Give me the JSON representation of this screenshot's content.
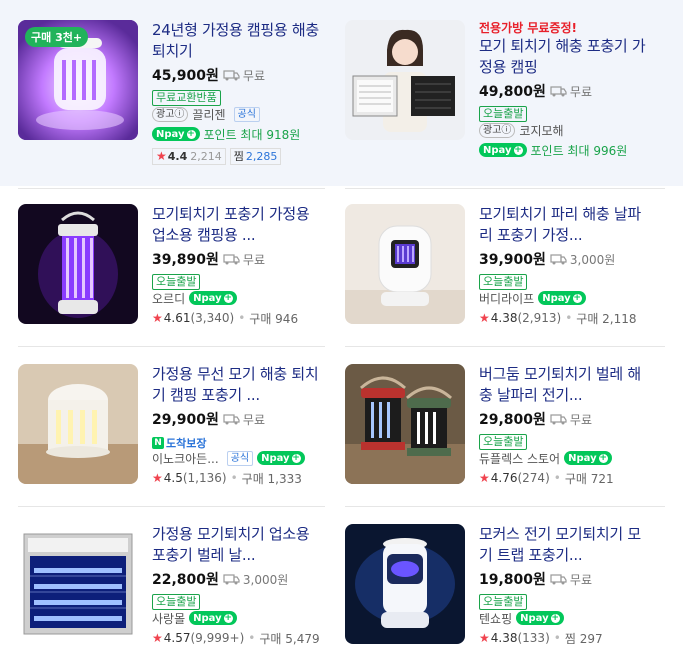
{
  "products": [
    {
      "badge": "구매 3천+",
      "title": "24년형 가정용 캠핑용 해충 퇴치기",
      "price": "45,900원",
      "shipping": "무료",
      "tag": "무료교환반품",
      "ad": "광고ⓘ",
      "seller": "끌리젠",
      "official": "공식",
      "npay": "pay",
      "point": "포인트 최대 918원",
      "rating": "4.4",
      "reviews": "2,214",
      "wish_label": "찜",
      "wish": "2,285"
    },
    {
      "promo": "전용가방 무료증정!",
      "title": "모기 퇴치기 해충 포충기 가정용 캠핑",
      "price": "49,800원",
      "shipping": "무료",
      "tag": "오늘출발",
      "ad": "광고ⓘ",
      "seller": "코지모해",
      "npay": "pay",
      "point": "포인트 최대 996원"
    },
    {
      "title": "모기퇴치기 포충기 가정용 업소용 캠핑용 ...",
      "price": "39,890원",
      "shipping": "무료",
      "tag": "오늘출발",
      "seller": "오르디",
      "npay": "pay",
      "rating": "4.61",
      "reviews": "(3,340)",
      "purchase": "구매 946"
    },
    {
      "title": "모기퇴치기 파리 해충 날파리 포충기 가정...",
      "price": "39,900원",
      "shipping": "3,000원",
      "tag": "오늘출발",
      "seller": "버디라이프",
      "npay": "pay",
      "rating": "4.38",
      "reviews": "(2,913)",
      "purchase": "구매 2,118"
    },
    {
      "title": "가정용 무선 모기 해충 퇴치기 캠핑 포충기 ...",
      "price": "29,900원",
      "shipping": "무료",
      "dochak": "도착보장",
      "seller": "이노크아든...",
      "official": "공식",
      "npay": "pay",
      "rating": "4.5",
      "reviews": "(1,136)",
      "purchase": "구매 1,333"
    },
    {
      "title": "버그둠 모기퇴치기 벌레 해충 날파리 전기...",
      "price": "29,800원",
      "shipping": "무료",
      "tag": "오늘출발",
      "seller": "듀플렉스 스토어",
      "npay": "pay",
      "rating": "4.76",
      "reviews": "(274)",
      "purchase": "구매 721"
    },
    {
      "title": "가정용 모기퇴치기 업소용 포충기 벌레 날...",
      "price": "22,800원",
      "shipping": "3,000원",
      "tag": "오늘출발",
      "seller": "사랑몰",
      "npay": "pay",
      "rating": "4.57",
      "reviews": "(9,999+)",
      "purchase": "구매 5,479"
    },
    {
      "title": "모커스 전기 모기퇴치기 모기 트랩 포충기...",
      "price": "19,800원",
      "shipping": "무료",
      "tag": "오늘출발",
      "seller": "텐쇼핑",
      "npay": "pay",
      "rating": "4.38",
      "reviews": "(133)",
      "purchase": "찜 297"
    }
  ],
  "colors": {
    "title": "#1d2c84",
    "green": "#1aa34a",
    "npay": "#03c75a",
    "star": "#f0434e",
    "promo": "#e8202a",
    "ad_band": "#f2f5fb"
  }
}
